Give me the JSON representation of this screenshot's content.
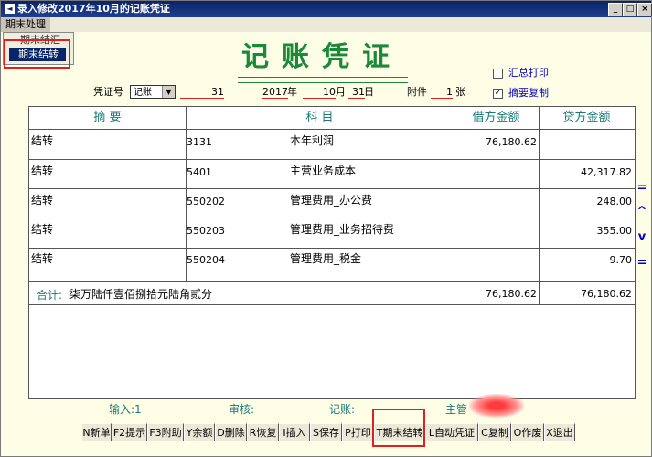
{
  "window": {
    "title": "录入修改2017年10月的记账凭证",
    "min": "_",
    "max": "□",
    "close": "×"
  },
  "menubar": {
    "items": [
      {
        "label": "期末处理"
      }
    ]
  },
  "dropdown": {
    "items": [
      {
        "label": "期末结汇"
      },
      {
        "label": "期末结转"
      }
    ]
  },
  "heading": "记账凭证",
  "options": {
    "summary_print": {
      "label": "汇总打印",
      "checked": false
    },
    "copy_summary": {
      "label": "摘要复制",
      "checked": true
    }
  },
  "voucher": {
    "number_label": "凭证号",
    "type": "记账",
    "number": "31",
    "year": "2017",
    "year_unit": "年",
    "month": "10",
    "month_unit": "月",
    "day": "31",
    "day_unit": "日",
    "attach_label": "附件",
    "attach_count": "1",
    "attach_unit": "张"
  },
  "table": {
    "headers": {
      "summary": "摘  要",
      "subject": "科  目",
      "debit": "借方金额",
      "credit": "贷方金额"
    },
    "rows": [
      {
        "summary": "结转",
        "code": "3131",
        "name": "本年利润",
        "debit": "76,180.62",
        "credit": ""
      },
      {
        "summary": "结转",
        "code": "5401",
        "name": "主营业务成本",
        "debit": "",
        "credit": "42,317.82"
      },
      {
        "summary": "结转",
        "code": "550202",
        "name": "管理费用_办公费",
        "debit": "",
        "credit": "248.00"
      },
      {
        "summary": "结转",
        "code": "550203",
        "name": "管理费用_业务招待费",
        "debit": "",
        "credit": "355.00"
      },
      {
        "summary": "结转",
        "code": "550204",
        "name": "管理费用_税金",
        "debit": "",
        "credit": "9.70"
      }
    ],
    "total": {
      "label": "合计:",
      "words": "柒万陆仟壹佰捌拾元陆角贰分",
      "debit": "76,180.62",
      "credit": "76,180.62"
    }
  },
  "side_buttons": [
    "=",
    "^",
    "v",
    "="
  ],
  "status": {
    "input": "输入:1",
    "audit": "审核:",
    "bookkeep": "记账:",
    "supervisor": "主管"
  },
  "toolbar": [
    {
      "label": "N新单"
    },
    {
      "label": "F2提示"
    },
    {
      "label": "F3附助"
    },
    {
      "label": "Y余额"
    },
    {
      "label": "D删除"
    },
    {
      "label": "R恢复"
    },
    {
      "label": "I插入"
    },
    {
      "label": "S保存"
    },
    {
      "label": "P打印"
    },
    {
      "label": "T期末结转"
    },
    {
      "label": "L自动凭证"
    },
    {
      "label": "C复制"
    },
    {
      "label": "O作废"
    },
    {
      "label": "X退出"
    }
  ],
  "colors": {
    "title_green": "#1a8a3a",
    "header_teal": "#1a7a7a",
    "highlight_red": "#e02020",
    "link_blue": "#0000c0"
  }
}
